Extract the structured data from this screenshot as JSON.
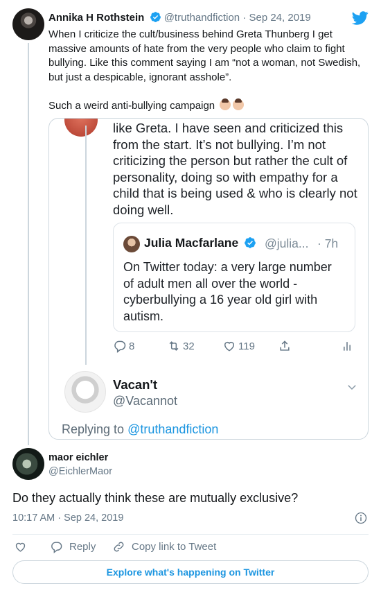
{
  "parent_tweet": {
    "author_name": "Annika H Rothstein",
    "handle": "@truthandfiction",
    "separator": " · ",
    "date": "Sep 24, 2019",
    "paragraphs": [
      "When I criticize the cult/business behind Greta Thunberg I get massive amounts of hate from the very people who claim to fight bullying. Like this comment saying I am “not a woman, not Swedish, but just a despicable, ignorant asshole”.",
      "Such a weird anti-bullying campaign"
    ],
    "emoji_names": [
      "woman-facepalming-emoji",
      "woman-facepalming-emoji"
    ]
  },
  "embedded_screenshot": {
    "tweet_text": "like Greta. I have seen and criticized this from the start. It’s not bullying. I’m not criticizing the person but rather the cult of personality, doing so with empathy for a child that is being used & who is clearly not doing well.",
    "quoted": {
      "name": "Julia Macfarlane",
      "handle": "@julia...",
      "time": "· 7h",
      "text": "On Twitter today: a very large number of adult men all over the world - cyberbullying a 16 year old girl with autism."
    },
    "actions": {
      "replies": "8",
      "retweets": "32",
      "likes": "119"
    },
    "reply_author": {
      "name": "Vacan't",
      "handle": "@Vacannot"
    },
    "replying_to_label": "Replying to",
    "replying_to_handle": "@truthandfiction"
  },
  "main_tweet": {
    "author_name": "maor eichler",
    "handle": "@EichlerMaor",
    "text": "Do they actually think these are mutually exclusive?",
    "timestamp": "10:17 AM · Sep 24, 2019",
    "reply_label": "Reply",
    "copy_link_label": "Copy link to Tweet"
  },
  "explore_button": "Explore what's happening on Twitter",
  "colors": {
    "twitter_blue": "#1da1f2",
    "link_blue": "#1b95e0",
    "secondary_text": "#657786",
    "border": "#ccd6dd"
  }
}
